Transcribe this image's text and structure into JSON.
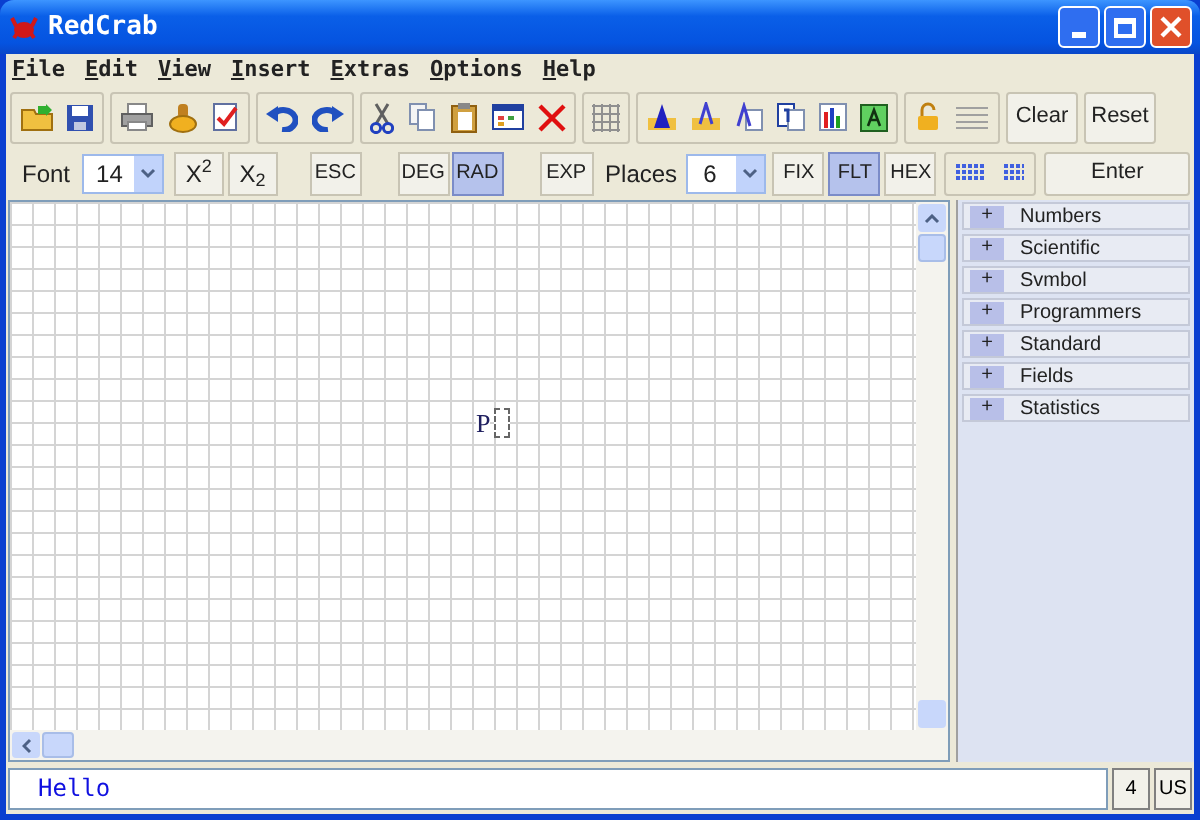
{
  "window": {
    "title": "RedCrab"
  },
  "menu": [
    "File",
    "Edit",
    "View",
    "Insert",
    "Extras",
    "Options",
    "Help"
  ],
  "toolbar": {
    "clear": "Clear",
    "reset": "Reset"
  },
  "format_bar": {
    "font_label": "Font",
    "font_size": "14",
    "superscript": "X$^{2}$",
    "subscript": "X$_{2}$",
    "esc": "ESC",
    "angle_modes": [
      {
        "label": "DEG",
        "selected": false
      },
      {
        "label": "RAD",
        "selected": true
      }
    ],
    "exp": "EXP",
    "places_label": "Places",
    "places": "6",
    "number_formats": [
      {
        "label": "FIX",
        "selected": false
      },
      {
        "label": "FLT",
        "selected": true
      },
      {
        "label": "HEX",
        "selected": false
      }
    ],
    "enter": "Enter"
  },
  "worksheet": {
    "text": "P"
  },
  "panels": [
    {
      "toggle": "+",
      "label": "Numbers"
    },
    {
      "toggle": "+",
      "label": "Scientific"
    },
    {
      "toggle": "+",
      "label": "Svmbol"
    },
    {
      "toggle": "+",
      "label": "Programmers"
    },
    {
      "toggle": "+",
      "label": "Standard"
    },
    {
      "toggle": "+",
      "label": "Fields"
    },
    {
      "toggle": "+",
      "label": "Statistics"
    }
  ],
  "status_bar": {
    "input": "Hello",
    "count": "4",
    "layout": "US"
  }
}
